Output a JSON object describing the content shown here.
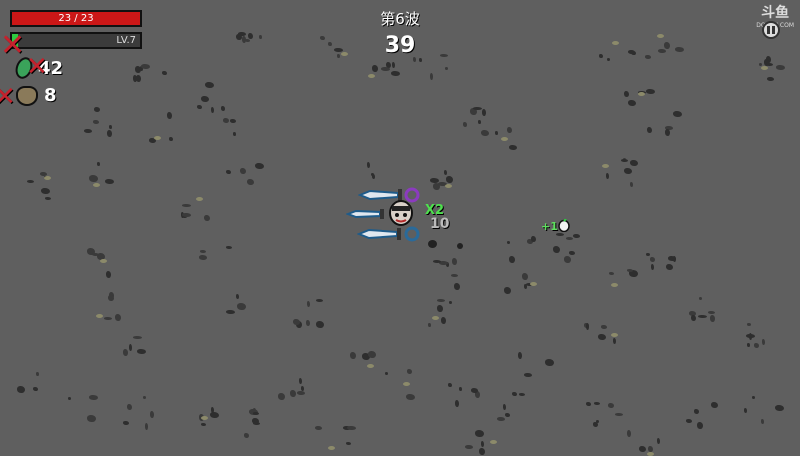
{
  "hud": {
    "hp_text": "23 / 23",
    "hp_fraction": 1.0,
    "level_text": "LV.7",
    "xp_fraction": 0.05,
    "materials_count": "42",
    "bag_count": "8"
  },
  "wave": {
    "label": "第6波",
    "timer": "39"
  },
  "combat": {
    "combo_text": "X2",
    "damage_text": "10",
    "heal_text": "+1"
  },
  "watermark": {
    "logo": "斗鱼",
    "url": "DOUYU.COM"
  },
  "colors": {
    "ground": "#5f5f5f",
    "hp": "#cc1717",
    "xp": "#2ecc40",
    "enemy": "#c5222d",
    "combo": "#4fe04f"
  }
}
